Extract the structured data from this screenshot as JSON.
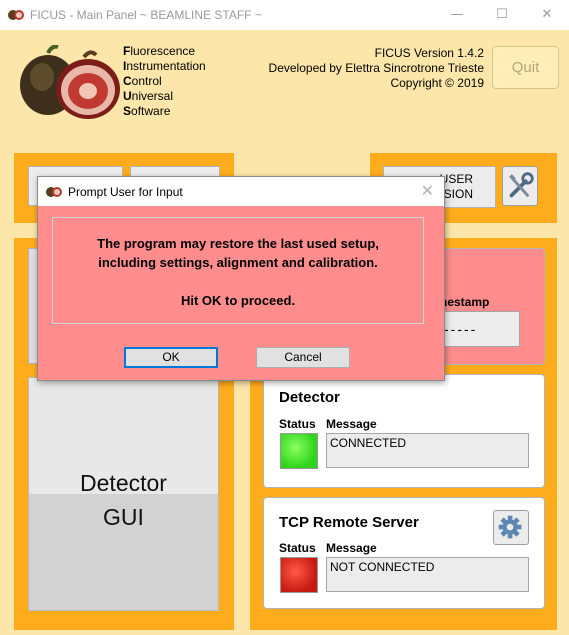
{
  "window": {
    "title": "FICUS - Main Panel ~ BEAMLINE STAFF ~",
    "minimize_glyph": "—",
    "maximize_glyph": "☐",
    "close_glyph": "✕"
  },
  "header": {
    "acronym": [
      {
        "cap": "F",
        "rest": "luorescence"
      },
      {
        "cap": "I",
        "rest": "nstrumentation"
      },
      {
        "cap": "C",
        "rest": "ontrol"
      },
      {
        "cap": "U",
        "rest": "niversal"
      },
      {
        "cap": "S",
        "rest": "oftware"
      }
    ],
    "version": "FICUS Version 1.4.2",
    "developer": "Developed by Elettra Sincrotrone Trieste",
    "copyright": "Copyright © 2019",
    "quit_label": "Quit"
  },
  "top_panel": {
    "user_btn_partial_line1": "USER",
    "user_btn_partial_line2": "SION"
  },
  "left": {
    "detector_gui_line1": "Detector",
    "detector_gui_line2": "GUI"
  },
  "pink_card": {
    "timestamp_label_partial": "nestamp",
    "timestamp_value_partial": "-----"
  },
  "detector": {
    "title": "Detector",
    "status_label": "Status",
    "message_label": "Message",
    "message": "CONNECTED",
    "status_color": "#3ee01f"
  },
  "tcp": {
    "title": "TCP Remote Server",
    "status_label": "Status",
    "message_label": "Message",
    "message": "NOT CONNECTED",
    "status_color": "#d8201a"
  },
  "dialog": {
    "title": "Prompt User for Input",
    "close_glyph": "✕",
    "line1": "The program may restore the last used setup,",
    "line2": "including settings, alignment and calibration.",
    "line3": "Hit OK to proceed.",
    "ok_label": "OK",
    "cancel_label": "Cancel"
  },
  "colors": {
    "background": "#fce6a9",
    "panel_orange": "#ffac1c",
    "dialog_bg": "#ff8d8d"
  }
}
